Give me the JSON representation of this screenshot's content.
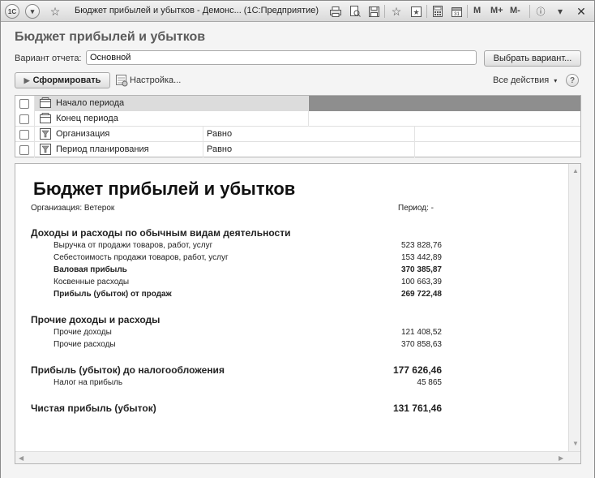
{
  "window": {
    "title": "Бюджет прибылей и убытков - Демонс...  (1С:Предприятие)",
    "app_badge": "1С",
    "m_label": "M",
    "mplus_label": "M+",
    "mminus_label": "M-",
    "close_glyph": "✕"
  },
  "form": {
    "title": "Бюджет прибылей и убытков",
    "variant_label": "Вариант отчета:",
    "variant_value": "Основной",
    "select_variant_button": "Выбрать вариант...",
    "generate_button": "Сформировать",
    "settings_button": "Настройка...",
    "all_actions": "Все действия",
    "help": "?"
  },
  "settings": {
    "rows": [
      {
        "name": "Начало периода",
        "condition": "",
        "value": ""
      },
      {
        "name": "Конец периода",
        "condition": "",
        "value": ""
      },
      {
        "name": "Организация",
        "condition": "Равно",
        "value": ""
      },
      {
        "name": "Период планирования",
        "condition": "Равно",
        "value": ""
      }
    ]
  },
  "report": {
    "title": "Бюджет прибылей и убытков",
    "org_line": "Организация: Ветерок",
    "period_line": "Период:  -",
    "sec1": {
      "title": "Доходы и расходы по обычным видам деятельности",
      "rows": [
        {
          "label": "Выручка от продажи товаров, работ, услуг",
          "value": "523 828,76"
        },
        {
          "label": "Себестоимость продажи товаров, работ, услуг",
          "value": "153 442,89"
        },
        {
          "label": "Валовая прибыль",
          "value": "370 385,87"
        },
        {
          "label": "Косвенные расходы",
          "value": "100 663,39"
        },
        {
          "label": "Прибыль (убыток) от продаж",
          "value": "269 722,48"
        }
      ]
    },
    "sec2": {
      "title": "Прочие доходы и расходы",
      "rows": [
        {
          "label": "Прочие доходы",
          "value": "121 408,52"
        },
        {
          "label": "Прочие расходы",
          "value": "370 858,63"
        }
      ]
    },
    "pretax": {
      "label": "Прибыль (убыток) до налогообложения",
      "value": "177 626,46"
    },
    "tax": {
      "label": "Налог на прибыль",
      "value": "45 865"
    },
    "net": {
      "label": "Чистая прибыль (убыток)",
      "value": "131 761,46"
    }
  }
}
